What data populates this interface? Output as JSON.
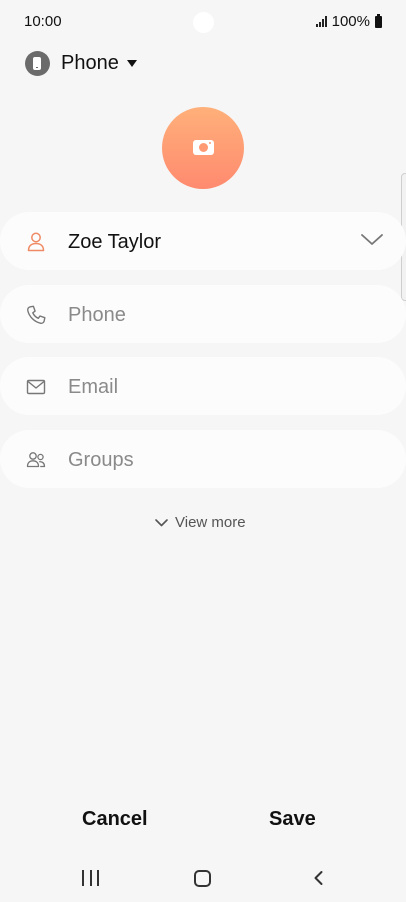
{
  "status_bar": {
    "time": "10:00",
    "battery": "100%"
  },
  "account_selector": {
    "label": "Phone",
    "icon": "phone-icon"
  },
  "photo": {
    "icon": "camera-icon",
    "colors": {
      "gradient_top": "#ffb07a",
      "gradient_bottom": "#ff8a6f"
    }
  },
  "fields": {
    "name": {
      "value": "Zoe Taylor",
      "icon": "person-icon",
      "expand_icon": "chevron-down-icon"
    },
    "phone": {
      "placeholder": "Phone",
      "icon": "phone-handset-icon"
    },
    "email": {
      "placeholder": "Email",
      "icon": "envelope-icon"
    },
    "groups": {
      "placeholder": "Groups",
      "icon": "people-icon"
    }
  },
  "view_more": {
    "label": "View more",
    "icon": "chevron-down-icon"
  },
  "actions": {
    "cancel_label": "Cancel",
    "save_label": "Save"
  },
  "navigation": {
    "recent_icon": "recent-apps-icon",
    "home_icon": "home-icon",
    "back_icon": "back-icon"
  },
  "colors": {
    "background": "#f6f6f6",
    "field_background": "#fcfcfc",
    "accent": "#ff8a6f",
    "placeholder": "#8a8a8a"
  }
}
